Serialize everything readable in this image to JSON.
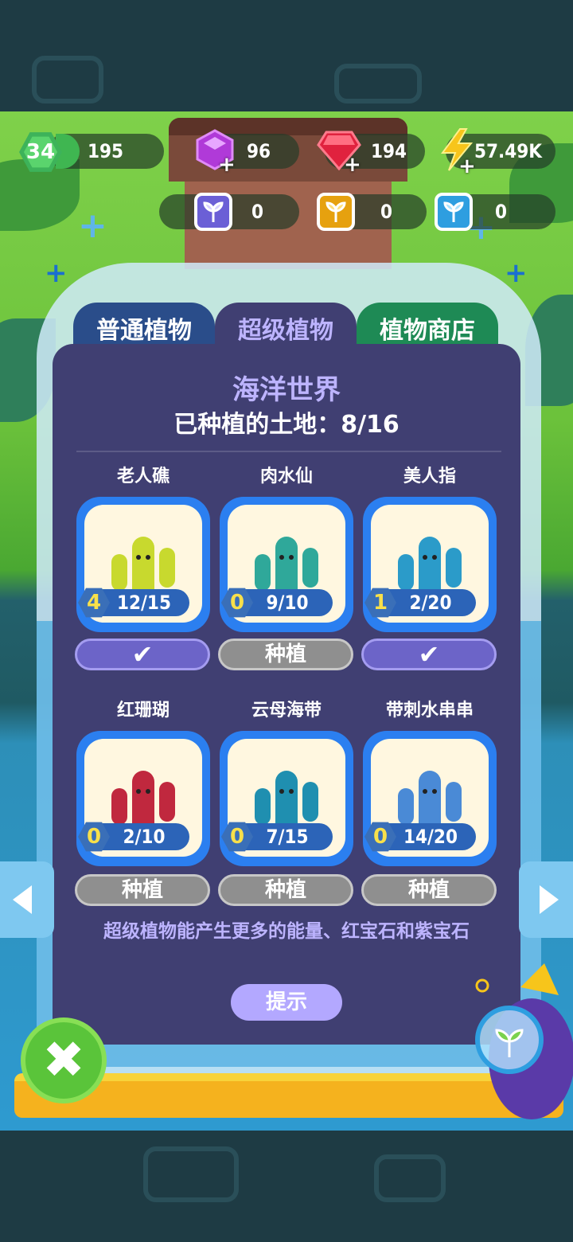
{
  "top_bar": {
    "level": "34",
    "xp": "195",
    "purple_gems": "96",
    "red_gems": "194",
    "energy": "57.49K",
    "plus": "+"
  },
  "seeds": {
    "purple": "0",
    "gold": "0",
    "blue": "0"
  },
  "tabs": [
    {
      "label": "普通植物"
    },
    {
      "label": "超级植物"
    },
    {
      "label": "植物商店"
    }
  ],
  "active_tab": 1,
  "world": {
    "title": "海洋世界",
    "land": "已种植的土地：8/16"
  },
  "plants": [
    {
      "name": "老人礁",
      "level": "4",
      "progress": "12/15",
      "planted": true,
      "button": "✔",
      "color": "#c8d92e"
    },
    {
      "name": "肉水仙",
      "level": "0",
      "progress": "9/10",
      "planted": false,
      "button": "种植",
      "color": "#2fa89a"
    },
    {
      "name": "美人指",
      "level": "1",
      "progress": "2/20",
      "planted": true,
      "button": "✔",
      "color": "#2b9bc9"
    },
    {
      "name": "红珊瑚",
      "level": "0",
      "progress": "2/10",
      "planted": false,
      "button": "种植",
      "color": "#c0283e"
    },
    {
      "name": "云母海带",
      "level": "0",
      "progress": "7/15",
      "planted": false,
      "button": "种植",
      "color": "#1f8fb0"
    },
    {
      "name": "带刺水串串",
      "level": "0",
      "progress": "14/20",
      "planted": false,
      "button": "种植",
      "color": "#4a8ad6"
    }
  ],
  "description": "超级植物能产生更多的能量、红宝石和紫宝石",
  "hint_button": "提示",
  "icons": {
    "close": "✖",
    "left": "◀",
    "right": "▶"
  }
}
